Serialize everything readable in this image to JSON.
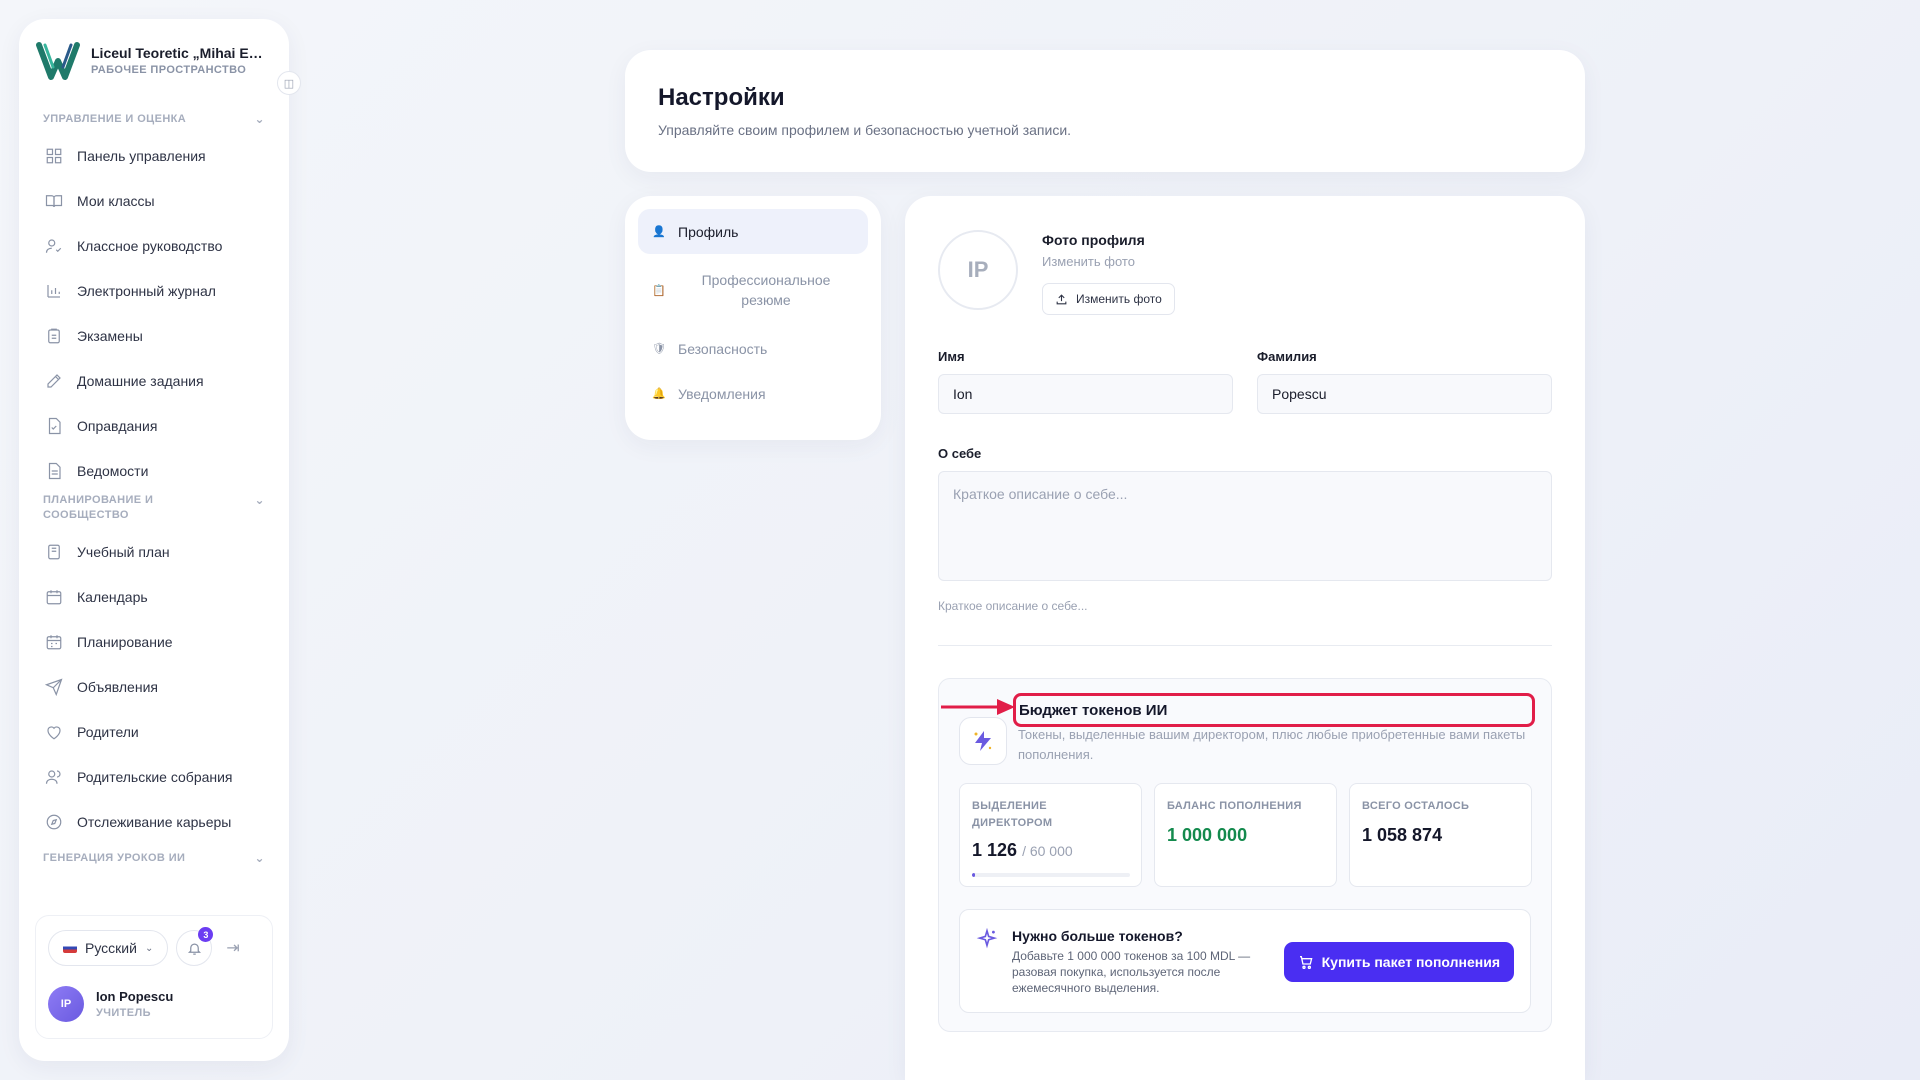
{
  "brand": {
    "name": "Liceul Teoretic „Mihai Emi...",
    "subtitle": "РАБОЧЕЕ ПРОСТРАНСТВО"
  },
  "sidebar": {
    "sections": [
      {
        "title": "УПРАВЛЕНИЕ И ОЦЕНКА",
        "items": [
          {
            "label": "Панель управления",
            "icon": "grid-icon"
          },
          {
            "label": "Мои классы",
            "icon": "book-icon"
          },
          {
            "label": "Классное руководство",
            "icon": "user-check-icon"
          },
          {
            "label": "Электронный журнал",
            "icon": "bar-chart-icon"
          },
          {
            "label": "Экзамены",
            "icon": "clipboard-icon"
          },
          {
            "label": "Домашние задания",
            "icon": "edit-icon"
          },
          {
            "label": "Оправдания",
            "icon": "file-check-icon"
          },
          {
            "label": "Ведомости",
            "icon": "file-text-icon"
          }
        ]
      },
      {
        "title": "ПЛАНИРОВАНИЕ И СООБЩЕСТВО",
        "items": [
          {
            "label": "Учебный план",
            "icon": "notebook-icon"
          },
          {
            "label": "Календарь",
            "icon": "calendar-icon"
          },
          {
            "label": "Планирование",
            "icon": "calendar-grid-icon"
          },
          {
            "label": "Объявления",
            "icon": "send-icon"
          },
          {
            "label": "Родители",
            "icon": "heart-icon"
          },
          {
            "label": "Родительские собрания",
            "icon": "users-icon"
          },
          {
            "label": "Отслеживание карьеры",
            "icon": "compass-icon"
          }
        ]
      },
      {
        "title": "ГЕНЕРАЦИЯ УРОКОВ ИИ",
        "items": []
      }
    ]
  },
  "footer": {
    "language": "Русский",
    "notifications": "3",
    "user_initials": "IP",
    "user_name": "Ion Popescu",
    "user_role": "УЧИТЕЛЬ"
  },
  "header": {
    "title": "Настройки",
    "subtitle": "Управляйте своим профилем и безопасностью учетной записи."
  },
  "tabs": [
    {
      "label": "Профиль",
      "active": true
    },
    {
      "label": "Профессиональное резюме",
      "active": false
    },
    {
      "label": "Безопасность",
      "active": false
    },
    {
      "label": "Уведомления",
      "active": false
    }
  ],
  "profile": {
    "initials": "IP",
    "photo_title": "Фото профиля",
    "photo_sub": "Изменить фото",
    "upload_label": "Изменить фото",
    "first_name_label": "Имя",
    "first_name": "Ion",
    "last_name_label": "Фамилия",
    "last_name": "Popescu",
    "about_label": "О себе",
    "about_placeholder": "Краткое описание о себе...",
    "about_hint": "Краткое описание о себе..."
  },
  "budget": {
    "title": "Бюджет токенов ИИ",
    "description": "Токены, выделенные вашим директором, плюс любые приобретенные вами пакеты пополнения.",
    "stats": [
      {
        "label": "ВЫДЕЛЕНИЕ ДИРЕКТОРОМ",
        "value": "1 126",
        "of": "/ 60 000",
        "progress": 0.019
      },
      {
        "label": "БАЛАНС ПОПОЛНЕНИЯ",
        "value": "1 000 000"
      },
      {
        "label": "ВСЕГО ОСТАЛОСЬ",
        "value": "1 058 874"
      }
    ],
    "more_title": "Нужно больше токенов?",
    "more_desc": "Добавьте 1 000 000 токенов за 100 MDL — разовая покупка, используется после ежемесячного выделения.",
    "buy_label": "Купить пакет пополнения"
  },
  "colors": {
    "accent": "#4a2ef2",
    "highlight": "#e11d48",
    "green": "#138a4d"
  }
}
